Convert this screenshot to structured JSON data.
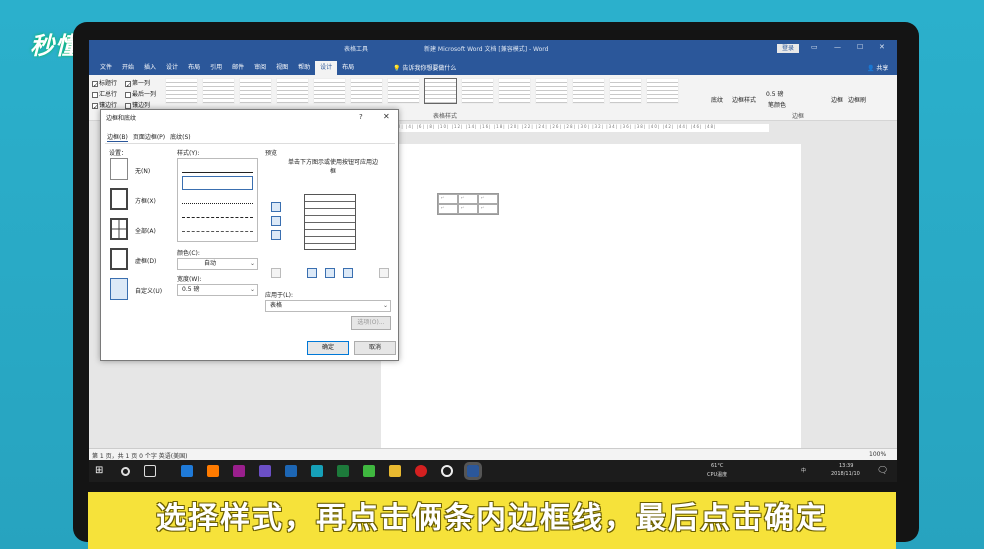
{
  "watermark": "秒懂视频",
  "word": {
    "title": "新建 Microsoft Word 文档 [兼容模式] - Word",
    "context_title": "表格工具",
    "login": "登录",
    "window_controls": [
      "▭",
      "—",
      "☐",
      "✕"
    ],
    "tabs": [
      "文件",
      "开始",
      "插入",
      "设计",
      "布局",
      "引用",
      "邮件",
      "审阅",
      "视图",
      "帮助",
      "设计",
      "布局"
    ],
    "active_tab_index": 10,
    "tell_me": "告诉我你想要做什么",
    "share": "共享",
    "style_options": [
      {
        "label": "标题行",
        "checked": true
      },
      {
        "label": "第一列",
        "checked": true
      },
      {
        "label": "汇总行",
        "checked": false
      },
      {
        "label": "最后一列",
        "checked": false
      },
      {
        "label": "镶边行",
        "checked": true
      },
      {
        "label": "镶边列",
        "checked": false
      }
    ],
    "group_label_styles": "表格样式",
    "group_label_borders": "边框",
    "shading": "底纹",
    "border_styles": "边框样式",
    "pen_weight": "0.5 磅",
    "pen_color": "笔颜色",
    "borders": "边框",
    "border_painter": "边框刷",
    "ruler": "L  |4|  |2|  |2|  |4|  |6|  |8|  |10|  |12|  |14|  |16|  |18|  |20|  |22|  |24|  |26|  |28|  |30|  |32|  |34|  |36|  |38|  |40|  |42|  |44|  |46|  |48|",
    "status_left": "第 1 页，共 1 页    0 个字    英语(美国)",
    "status_zoom": "100%"
  },
  "dialog": {
    "title": "边框和底纹",
    "help": "?",
    "close": "✕",
    "tabs": [
      "边框(B)",
      "页面边框(P)",
      "底纹(S)"
    ],
    "settings_label": "设置：",
    "settings": [
      "无(N)",
      "方框(X)",
      "全部(A)",
      "虚框(D)",
      "自定义(U)"
    ],
    "style_label": "样式(Y):",
    "color_label": "颜色(C):",
    "color_value": "自动",
    "width_label": "宽度(W):",
    "width_value": "0.5 磅",
    "preview_label": "预览",
    "preview_hint": "单击下方图示或使用按钮可应用边框",
    "apply_to_label": "应用于(L):",
    "apply_to_value": "表格",
    "options_button": "选项(O)...",
    "ok": "确定",
    "cancel": "取消"
  },
  "taskbar": {
    "temp": "61°C",
    "temp_label": "CPU温度",
    "ime": "中",
    "time": "13:39",
    "date": "2018/11/10"
  },
  "caption": "选择样式，再点击俩条内边框线，最后点击确定"
}
